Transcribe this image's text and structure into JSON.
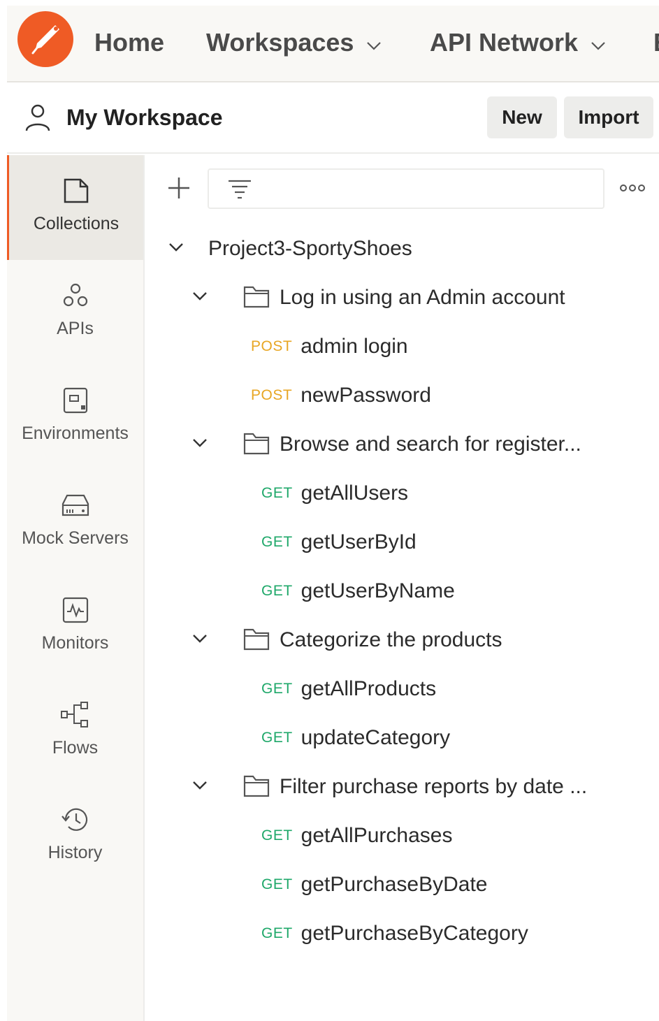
{
  "topnav": {
    "home": "Home",
    "workspaces": "Workspaces",
    "api_network": "API Network",
    "more": "E"
  },
  "workspace": {
    "title": "My Workspace",
    "new_label": "New",
    "import_label": "Import"
  },
  "sidebar": {
    "items": [
      {
        "label": "Collections",
        "icon": "collections-icon",
        "active": true
      },
      {
        "label": "APIs",
        "icon": "apis-icon"
      },
      {
        "label": "Environments",
        "icon": "environments-icon"
      },
      {
        "label": "Mock Servers",
        "icon": "mock-servers-icon"
      },
      {
        "label": "Monitors",
        "icon": "monitors-icon"
      },
      {
        "label": "Flows",
        "icon": "flows-icon"
      },
      {
        "label": "History",
        "icon": "history-icon"
      }
    ]
  },
  "collection": {
    "name": "Project3-SportyShoes",
    "folders": [
      {
        "name": "Log in using an Admin account",
        "requests": [
          {
            "method": "POST",
            "name": "admin login"
          },
          {
            "method": "POST",
            "name": "newPassword"
          }
        ]
      },
      {
        "name": "Browse and search for register...",
        "requests": [
          {
            "method": "GET",
            "name": "getAllUsers"
          },
          {
            "method": "GET",
            "name": "getUserById"
          },
          {
            "method": "GET",
            "name": "getUserByName"
          }
        ]
      },
      {
        "name": "Categorize the products",
        "requests": [
          {
            "method": "GET",
            "name": "getAllProducts"
          },
          {
            "method": "GET",
            "name": "updateCategory"
          }
        ]
      },
      {
        "name": "Filter purchase reports by date ...",
        "requests": [
          {
            "method": "GET",
            "name": "getAllPurchases"
          },
          {
            "method": "GET",
            "name": "getPurchaseByDate"
          },
          {
            "method": "GET",
            "name": "getPurchaseByCategory"
          }
        ]
      }
    ]
  },
  "colors": {
    "brand": "#ef5b25",
    "post": "#e8a623",
    "get": "#1fa86a"
  }
}
